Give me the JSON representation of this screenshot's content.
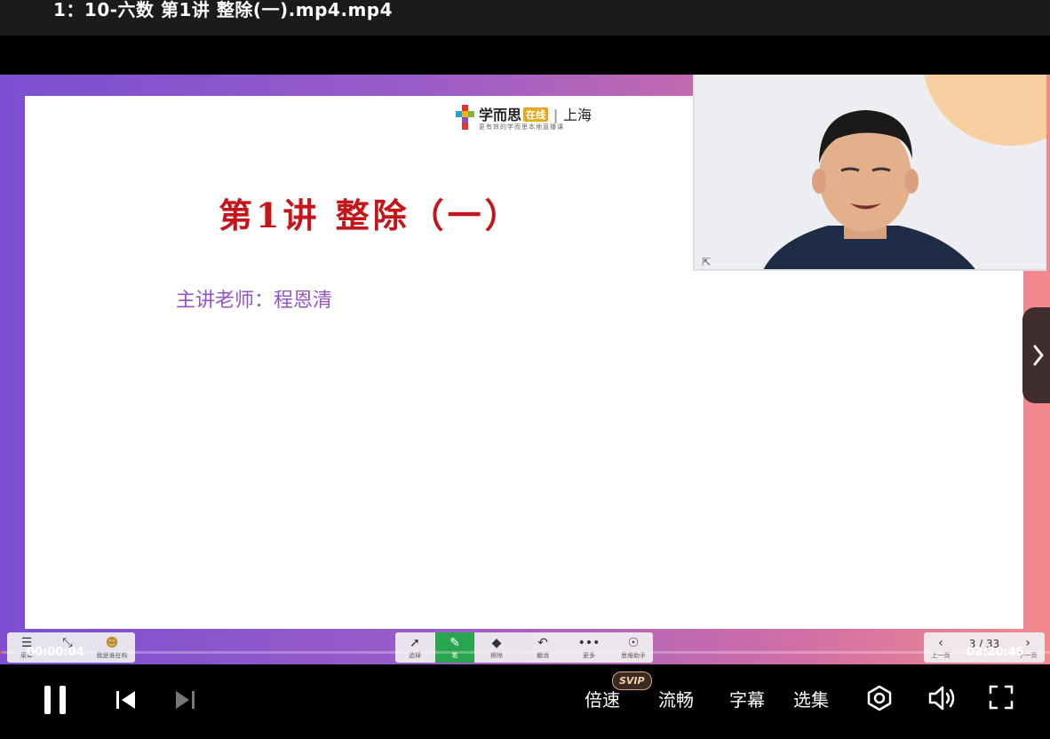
{
  "window": {
    "title": "1：10-六数 第1讲 整除(一).mp4.mp4"
  },
  "slide": {
    "brand": {
      "name": "学而思",
      "badge": "在线",
      "city": "上海",
      "slogan": "更有效的学而思本地直播课"
    },
    "title": "第1讲  整除（一）",
    "teacher": "主讲老师：程恩清"
  },
  "courseware_toolbar": {
    "left_buttons": [
      {
        "icon": "menu-icon",
        "label": "菜单"
      },
      {
        "icon": "shrink-icon",
        "label": ""
      },
      {
        "icon": "mascot-icon",
        "label": "我是谁在构"
      }
    ],
    "tools": [
      {
        "icon": "cursor-icon",
        "label": "选择",
        "active": false
      },
      {
        "icon": "pen-icon",
        "label": "笔",
        "active": true
      },
      {
        "icon": "eraser-icon",
        "label": "擦除",
        "active": false
      },
      {
        "icon": "undo-icon",
        "label": "撤消",
        "active": false
      },
      {
        "icon": "more-icon",
        "label": "更多",
        "active": false
      },
      {
        "icon": "robot-icon",
        "label": "思维助手",
        "active": false
      }
    ],
    "pager": {
      "prev_label": "上一页",
      "next_label": "下一页",
      "counter": "3 / 33"
    }
  },
  "player": {
    "current_time": "00:00:04",
    "total_time": "02:20:46",
    "progress": 0.0005,
    "buttons": {
      "speed": "倍速",
      "vip_badge": "SVIP",
      "quality": "流畅",
      "subtitle": "字幕",
      "episodes": "选集"
    },
    "accent_color": "#e54d42"
  }
}
